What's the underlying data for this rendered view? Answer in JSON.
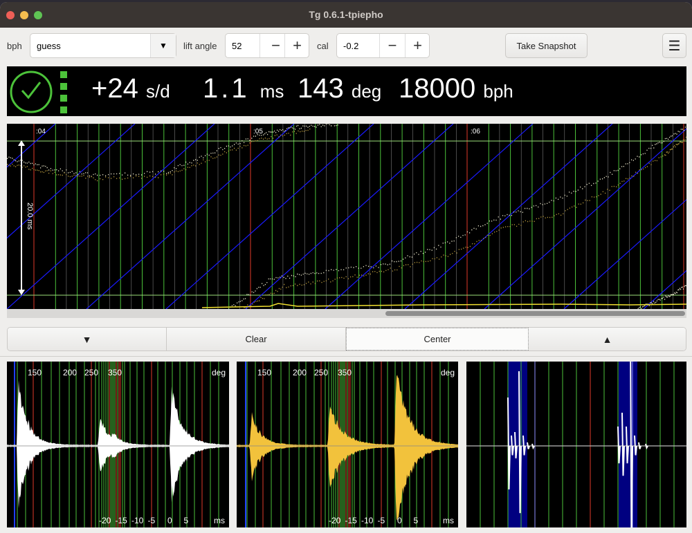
{
  "window": {
    "title": "Tg 0.6.1-tpiepho"
  },
  "toolbar": {
    "bph_label": "bph",
    "bph_value": "guess",
    "lift_label": "lift angle",
    "lift_value": "52",
    "cal_label": "cal",
    "cal_value": "-0.2",
    "minus": "−",
    "plus": "+",
    "snapshot": "Take Snapshot",
    "menu_icon": "hamburger-menu-icon"
  },
  "display": {
    "rate": "+24",
    "rate_unit": "s/d",
    "beat_error": "1.1",
    "beat_error_unit": "ms",
    "amplitude": "143",
    "amplitude_unit": "deg",
    "bph": "18000",
    "bph_unit": "bph",
    "status_icon": "clock-check-icon",
    "status_color": "#4cc23a"
  },
  "timegrapher": {
    "time_labels": [
      ":04",
      ":05",
      ":06"
    ],
    "scale_label": "20.0 ms"
  },
  "controls": {
    "down_icon": "triangle-down-icon",
    "clear": "Clear",
    "center": "Center",
    "up_icon": "triangle-up-icon"
  },
  "waveforms": {
    "deg_ticks": [
      "150",
      "200",
      "250",
      "350"
    ],
    "deg_unit": "deg",
    "ms_ticks": [
      "-20",
      "-15",
      "-10",
      "-5",
      "0",
      "5"
    ],
    "ms_unit": "ms",
    "tick_color": "#ffffff",
    "tock_color": "#f2c23c"
  }
}
